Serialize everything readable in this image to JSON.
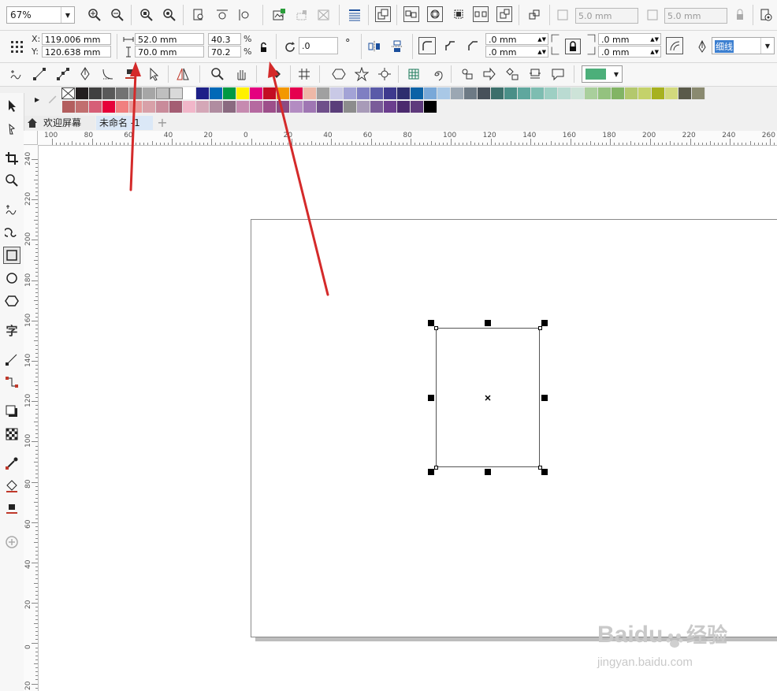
{
  "toolbar_top": {
    "zoom": "67%",
    "nudge_x": "5.0 mm",
    "nudge_y": "5.0 mm"
  },
  "props": {
    "x_label": "X:",
    "y_label": "Y:",
    "x_value": "119.006 mm",
    "y_value": "120.638 mm",
    "width": "52.0 mm",
    "height": "70.0 mm",
    "scale_w": "40.3",
    "scale_h": "70.2",
    "percent": "%",
    "rotation": ".0",
    "degree": "°",
    "corner_1": ".0 mm",
    "corner_2": ".0 mm",
    "corner_3": ".0 mm",
    "corner_4": ".0 mm",
    "outline": "细线"
  },
  "palette": {
    "row1": [
      "#231f20",
      "#404040",
      "#595959",
      "#737373",
      "#8c8c8c",
      "#a6a6a6",
      "#bfbfbf",
      "#d9d9d9",
      "#ffffff",
      "#1d2088",
      "#0068b7",
      "#009944",
      "#fff100",
      "#e4007f",
      "#c30d23",
      "#f39800",
      "#e5004f",
      "#eeb8a7",
      "#a0a0a0",
      "#c9c9e6",
      "#a3a3d6",
      "#7f7fc2",
      "#5a5aa8",
      "#3e3a8e",
      "#2e2e6e",
      "#0b62a6",
      "#79a8d8",
      "#a9c8e6",
      "#9ba7b3",
      "#6d7a85",
      "#47515a",
      "#3c6f6b",
      "#4a8f88",
      "#5fa79e",
      "#7dbdb1",
      "#9dcfc3",
      "#badbd2",
      "#cde3d8",
      "#a9cf9c",
      "#94c27f",
      "#82b464",
      "#b3c86d",
      "#c4d26a",
      "#a7b11f",
      "#d2d97d",
      "#5a5a4a",
      "#8a8a70"
    ],
    "row2": [
      "#b35e5e",
      "#c16f6f",
      "#d65e77",
      "#e60039",
      "#f08080",
      "#e89a9a",
      "#d8a0a8",
      "#c98b9a",
      "#a45d73",
      "#f1b6c9",
      "#d4a7b7",
      "#b08ca0",
      "#8a6a80",
      "#c68bb0",
      "#b569a0",
      "#9d4f8a",
      "#8c4b83",
      "#b38cc2",
      "#9f76b3",
      "#6f4f8a",
      "#5a3e7a",
      "#8c8c8c",
      "#a89bb8",
      "#7a5c99",
      "#6b3e8e",
      "#4b2a6e",
      "#5e3a7c",
      "#000000"
    ]
  },
  "tabs": {
    "welcome": "欢迎屏幕",
    "doc": "未命名 -1",
    "add": "+"
  },
  "ruler_h": [
    "100",
    "80",
    "60",
    "40",
    "20",
    "0",
    "20",
    "40",
    "60",
    "80",
    "100",
    "120",
    "140",
    "160",
    "180",
    "200",
    "220",
    "240",
    "260"
  ],
  "ruler_v": [
    "240",
    "220",
    "200",
    "180",
    "160",
    "140",
    "120",
    "100",
    "80",
    "60",
    "40",
    "20",
    "0",
    "20"
  ],
  "watermark": {
    "brand_latin": "Baidu",
    "brand_cjk": "经验",
    "url": "jingyan.baidu.com"
  }
}
